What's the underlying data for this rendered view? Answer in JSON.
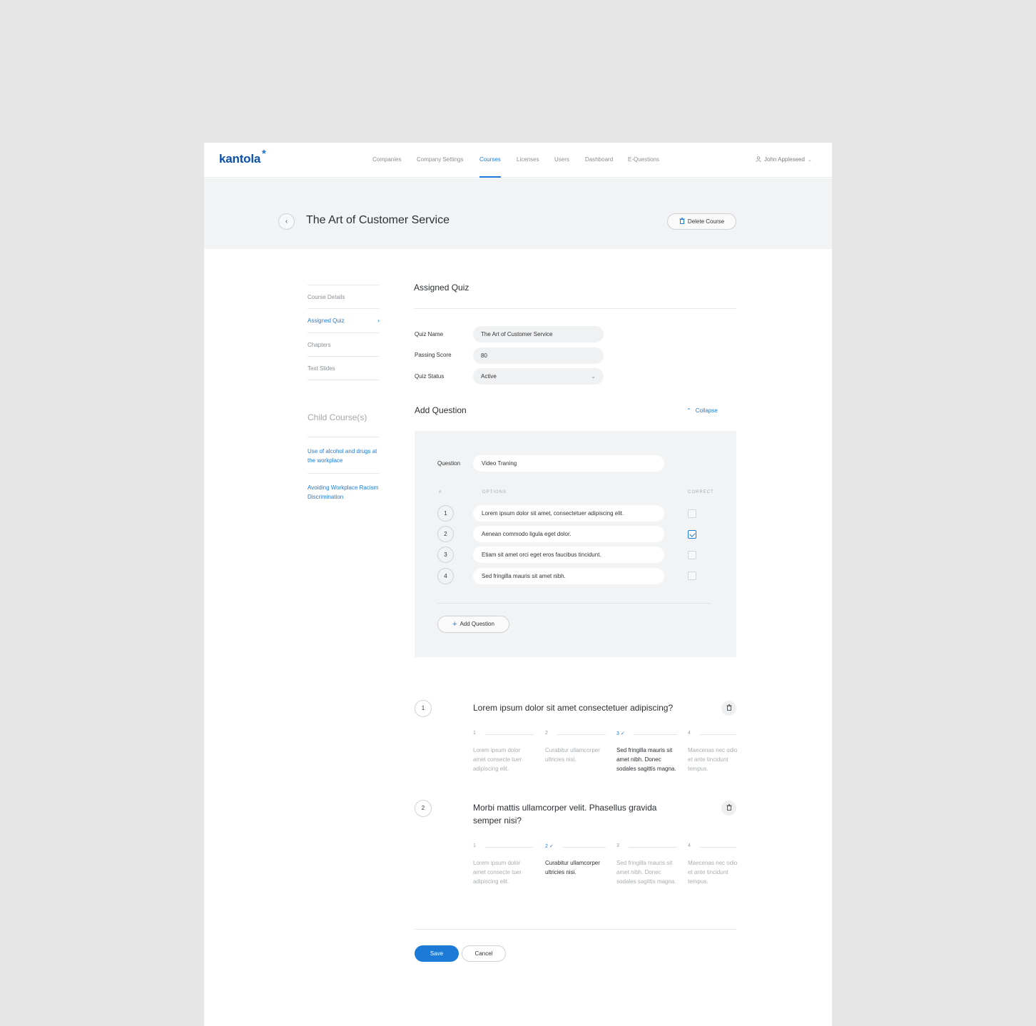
{
  "brand": {
    "logo_text": "kantola",
    "logo_mark": "*",
    "accent": "#1d7bd8"
  },
  "nav": {
    "items": [
      {
        "label": "Companies"
      },
      {
        "label": "Company Settings"
      },
      {
        "label": "Courses"
      },
      {
        "label": "Licenses"
      },
      {
        "label": "Users"
      },
      {
        "label": "Dashboard"
      },
      {
        "label": "E-Questions"
      }
    ],
    "active": "Courses",
    "user_name": "John Appleseed"
  },
  "header": {
    "title": "The Art of Customer Service",
    "delete_label": "Delete Course"
  },
  "sidebar": {
    "items": [
      {
        "label": "Course Details"
      },
      {
        "label": "Assigned Quiz"
      },
      {
        "label": "Chapters"
      },
      {
        "label": "Text Slides"
      }
    ],
    "active": "Assigned Quiz",
    "child_heading": "Child Course(s)",
    "children": [
      {
        "label": "Use of alcohol and drugs at the workplace"
      },
      {
        "label": "Avoiding Workplace Racism Discrimination"
      }
    ]
  },
  "quiz": {
    "section_title": "Assigned Quiz",
    "fields": {
      "name_label": "Quiz Name",
      "name_value": "The Art of Customer Service",
      "score_label": "Passing Score",
      "score_value": "80",
      "status_label": "Quiz Status",
      "status_value": "Active"
    }
  },
  "add_question": {
    "title": "Add Question",
    "collapse_label": "Collapse",
    "question_label": "Question",
    "question_value": "Video Traning",
    "col_number": "#",
    "col_options": "OPTIONS",
    "col_correct": "CORRECT",
    "options": [
      {
        "num": "1",
        "text": "Lorem ipsum dolor sit amet, consectetuer adipiscing elit.",
        "correct": false
      },
      {
        "num": "2",
        "text": "Aenean commodo ligula eget dolor.",
        "correct": true
      },
      {
        "num": "3",
        "text": "Etiam sit amet orci eget eros faucibus tincidunt.",
        "correct": false
      },
      {
        "num": "4",
        "text": "Sed fringilla mauris sit amet nibh.",
        "correct": false
      }
    ],
    "add_button_label": "Add Question"
  },
  "questions": [
    {
      "num": "1",
      "text": "Lorem ipsum dolor sit amet consectetuer adipiscing?",
      "options": [
        {
          "num": "1",
          "text": "Lorem ipsum dolor amet consecte tuer adipiscing elit.",
          "correct": false
        },
        {
          "num": "2",
          "text": "Curabitur ullamcorper ultricies nisi.",
          "correct": false
        },
        {
          "num": "3",
          "text": "Sed fringilla mauris sit amet nibh. Donec sodales sagittis magna.",
          "correct": true
        },
        {
          "num": "4",
          "text": "Maecenas nec odio et ante tincidunt tempus.",
          "correct": false
        }
      ]
    },
    {
      "num": "2",
      "text": "Morbi mattis ullamcorper velit. Phasellus gravida semper nisi?",
      "options": [
        {
          "num": "1",
          "text": "Lorem ipsum dolor amet consecte tuer adipiscing elit.",
          "correct": false
        },
        {
          "num": "2",
          "text": "Curabitur ullamcorper ultricies nisi.",
          "correct": true
        },
        {
          "num": "3",
          "text": "Sed fringilla mauris sit amet nibh. Donec sodales sagittis magna.",
          "correct": false
        },
        {
          "num": "4",
          "text": "Maecenas nec odio et ante tincidunt tempus.",
          "correct": false
        }
      ]
    }
  ],
  "footer": {
    "save_label": "Save",
    "cancel_label": "Cancel"
  },
  "icons": {
    "back": "chevron-left-icon",
    "delete": "trash-icon",
    "user": "user-icon",
    "dropdown": "chevron-down-icon",
    "collapse": "chevron-up-icon",
    "add": "plus-icon",
    "correct": "check-icon"
  }
}
